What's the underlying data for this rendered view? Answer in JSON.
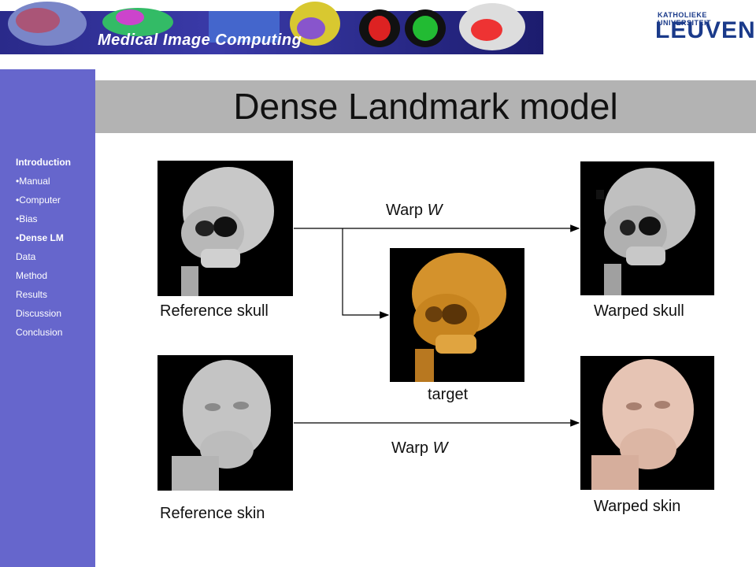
{
  "header": {
    "banner_title": "Medical Image Computing",
    "logo_small": "KATHOLIEKE UNIVERSITEIT",
    "logo_big": "LEUVEN"
  },
  "slide": {
    "title": "Dense Landmark model"
  },
  "nav": {
    "items": [
      {
        "label": "Introduction",
        "bold": true
      },
      {
        "label": "•Manual"
      },
      {
        "label": "•Computer"
      },
      {
        "label": "•Bias"
      },
      {
        "label": "•Dense LM",
        "bold": true
      },
      {
        "label": "Data"
      },
      {
        "label": "Method"
      },
      {
        "label": "Results"
      },
      {
        "label": "Discussion"
      },
      {
        "label": "Conclusion"
      }
    ]
  },
  "diagram": {
    "reference_skull": "Reference skull",
    "warped_skull": "Warped skull",
    "target": "target",
    "reference_skin": "Reference skin",
    "warped_skin": "Warped skin",
    "warp_top_prefix": "Warp",
    "warp_top_var": "W",
    "warp_bottom_prefix": "Warp",
    "warp_bottom_var": "W"
  },
  "colors": {
    "sidebar": "#6666cc",
    "title_band": "#b3b3b3",
    "logo": "#1a3a8a",
    "target_render": "#d4922c",
    "warped_skin_render": "#e6c4b4"
  }
}
